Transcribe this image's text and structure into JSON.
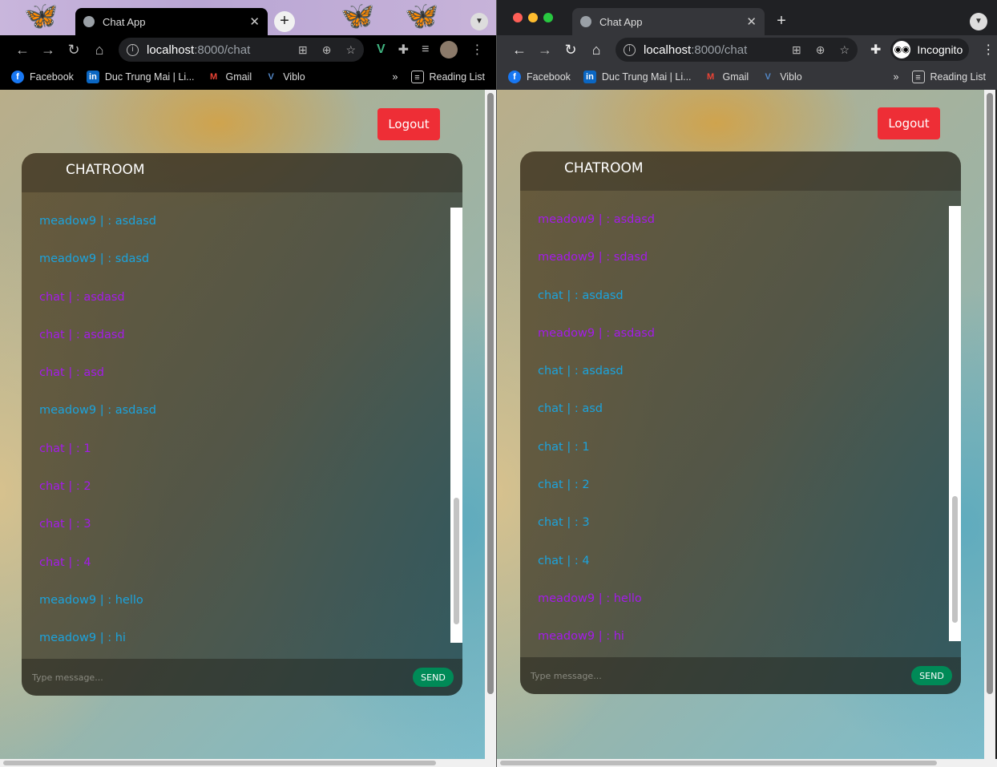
{
  "colors": {
    "own": "#1ba3dd",
    "other": "#a41bea",
    "logout": "#ee2e36",
    "send": "#008a57"
  },
  "windows": [
    {
      "tab_title": "Chat App",
      "url_host": "localhost",
      "url_rest": ":8000/chat",
      "bookmarks": [
        "Facebook",
        "Duc Trung Mai | Li...",
        "Gmail",
        "Viblo"
      ],
      "reading_list": "Reading List",
      "more": "»",
      "logout": "Logout",
      "chat_title": "CHATROOM",
      "placeholder": "Type message...",
      "send": "SEND",
      "messages": [
        {
          "user": "meadow9",
          "text": "asdasd",
          "own": true
        },
        {
          "user": "meadow9",
          "text": "sdasd",
          "own": true
        },
        {
          "user": "chat",
          "text": "asdasd",
          "own": false
        },
        {
          "user": "chat",
          "text": "asdasd",
          "own": false
        },
        {
          "user": "chat",
          "text": "asd",
          "own": false
        },
        {
          "user": "meadow9",
          "text": "asdasd",
          "own": true
        },
        {
          "user": "chat",
          "text": "1",
          "own": false
        },
        {
          "user": "chat",
          "text": "2",
          "own": false
        },
        {
          "user": "chat",
          "text": "3",
          "own": false
        },
        {
          "user": "chat",
          "text": "4",
          "own": false
        },
        {
          "user": "meadow9",
          "text": "hello",
          "own": true
        },
        {
          "user": "meadow9",
          "text": "hi",
          "own": true
        }
      ]
    },
    {
      "tab_title": "Chat App",
      "url_host": "localhost",
      "url_rest": ":8000/chat",
      "incognito": "Incognito",
      "bookmarks": [
        "Facebook",
        "Duc Trung Mai | Li...",
        "Gmail",
        "Viblo"
      ],
      "reading_list": "Reading List",
      "more": "»",
      "logout": "Logout",
      "chat_title": "CHATROOM",
      "placeholder": "Type message...",
      "send": "SEND",
      "messages": [
        {
          "user": "meadow9",
          "text": "asdasd",
          "own": false
        },
        {
          "user": "meadow9",
          "text": "sdasd",
          "own": false
        },
        {
          "user": "chat",
          "text": "asdasd",
          "own": true
        },
        {
          "user": "meadow9",
          "text": "asdasd",
          "own": false
        },
        {
          "user": "chat",
          "text": "asdasd",
          "own": true
        },
        {
          "user": "chat",
          "text": "asd",
          "own": true
        },
        {
          "user": "chat",
          "text": "1",
          "own": true
        },
        {
          "user": "chat",
          "text": "2",
          "own": true
        },
        {
          "user": "chat",
          "text": "3",
          "own": true
        },
        {
          "user": "chat",
          "text": "4",
          "own": true
        },
        {
          "user": "meadow9",
          "text": "hello",
          "own": false
        },
        {
          "user": "meadow9",
          "text": "hi",
          "own": false
        }
      ]
    }
  ]
}
